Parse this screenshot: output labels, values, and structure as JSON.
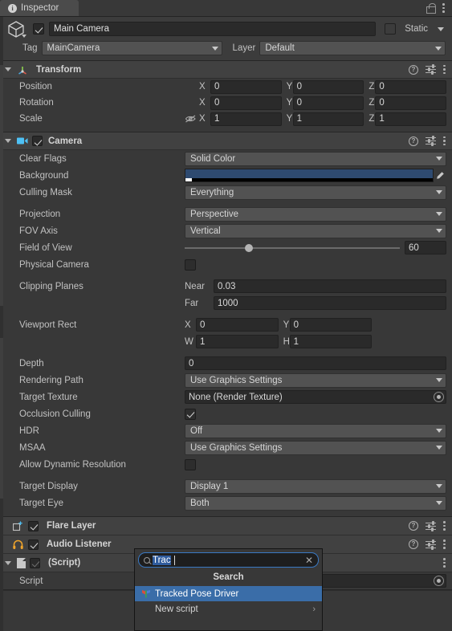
{
  "tab": {
    "label": "Inspector",
    "info_icon": "info-icon",
    "lock_icon": "lock-icon",
    "menu_icon": "kebab-menu-icon"
  },
  "gameobject": {
    "icon": "cube-icon",
    "enabled": true,
    "name": "Main Camera",
    "static_label": "Static",
    "static_checked": false,
    "tag_label": "Tag",
    "tag_value": "MainCamera",
    "layer_label": "Layer",
    "layer_value": "Default"
  },
  "components": [
    {
      "name": "Transform",
      "icon": "transform-axis-icon",
      "expanded": true,
      "has_checkbox": false,
      "rows": [
        {
          "label": "Position",
          "type": "vector3",
          "x": "0",
          "y": "0",
          "z": "0"
        },
        {
          "label": "Rotation",
          "type": "vector3",
          "x": "0",
          "y": "0",
          "z": "0"
        },
        {
          "label": "Scale",
          "type": "vector3",
          "x": "1",
          "y": "1",
          "z": "1",
          "link_icon": "eye-off-icon"
        }
      ]
    },
    {
      "name": "Camera",
      "icon": "camera-icon",
      "expanded": true,
      "has_checkbox": true,
      "enabled": true,
      "rows": [
        {
          "label": "Clear Flags",
          "type": "dropdown",
          "value": "Solid Color"
        },
        {
          "label": "Background",
          "type": "color",
          "color": "#2e4a70",
          "alpha_icon": "eyedropper-icon"
        },
        {
          "label": "Culling Mask",
          "type": "dropdown",
          "value": "Everything"
        },
        {
          "label": "Projection",
          "type": "dropdown",
          "value": "Perspective"
        },
        {
          "label": "FOV Axis",
          "type": "dropdown",
          "value": "Vertical"
        },
        {
          "label": "Field of View",
          "type": "slider",
          "value": "60",
          "percent": 30
        },
        {
          "label": "Physical Camera",
          "type": "checkbox",
          "checked": false
        },
        {
          "label": "Clipping Planes",
          "type": "pair",
          "a_label": "Near",
          "a_value": "0.03",
          "b_label": "Far",
          "b_value": "1000"
        },
        {
          "label": "Viewport Rect",
          "type": "rect",
          "x_label": "X",
          "x_value": "0",
          "y_label": "Y",
          "y_value": "0",
          "w_label": "W",
          "w_value": "1",
          "h_label": "H",
          "h_value": "1"
        },
        {
          "label": "Depth",
          "type": "text",
          "value": "0"
        },
        {
          "label": "Rendering Path",
          "type": "dropdown",
          "value": "Use Graphics Settings"
        },
        {
          "label": "Target Texture",
          "type": "object",
          "value": "None (Render Texture)"
        },
        {
          "label": "Occlusion Culling",
          "type": "checkbox",
          "checked": true
        },
        {
          "label": "HDR",
          "type": "dropdown",
          "value": "Off"
        },
        {
          "label": "MSAA",
          "type": "dropdown",
          "value": "Use Graphics Settings"
        },
        {
          "label": "Allow Dynamic Resolution",
          "type": "checkbox",
          "checked": false
        },
        {
          "label": "Target Display",
          "type": "dropdown",
          "value": "Display 1"
        },
        {
          "label": "Target Eye",
          "type": "dropdown",
          "value": "Both"
        }
      ]
    }
  ],
  "thin_components": [
    {
      "name": "Flare Layer",
      "icon": "flare-layer-icon",
      "enabled": true
    },
    {
      "name": "Audio Listener",
      "icon": "headphones-icon",
      "enabled": true
    }
  ],
  "script_component": {
    "name": "(Script)",
    "icon": "script-file-icon",
    "enabled": true,
    "checkbox_dim": true,
    "field_label": "Script",
    "field_value": ""
  },
  "search_popup": {
    "search_icon": "magnifier-icon",
    "query": "Trac",
    "clear_icon": "close-icon",
    "title": "Search",
    "items": [
      {
        "label": "Tracked Pose Driver",
        "selected": true,
        "icon": "script-asset-icon",
        "has_arrow": false
      },
      {
        "label": "New script",
        "selected": false,
        "icon": "",
        "has_arrow": true
      }
    ],
    "submenu_arrow": "chevron-right-icon"
  },
  "colors": {
    "panel_bg": "#383838",
    "header_bg": "#414141",
    "field_bg": "#2a2a2a",
    "dropdown_bg": "#525252",
    "selection_blue": "#3a6da8",
    "accent_border": "#3a79c4",
    "background_color_value": "#2e4a70"
  }
}
